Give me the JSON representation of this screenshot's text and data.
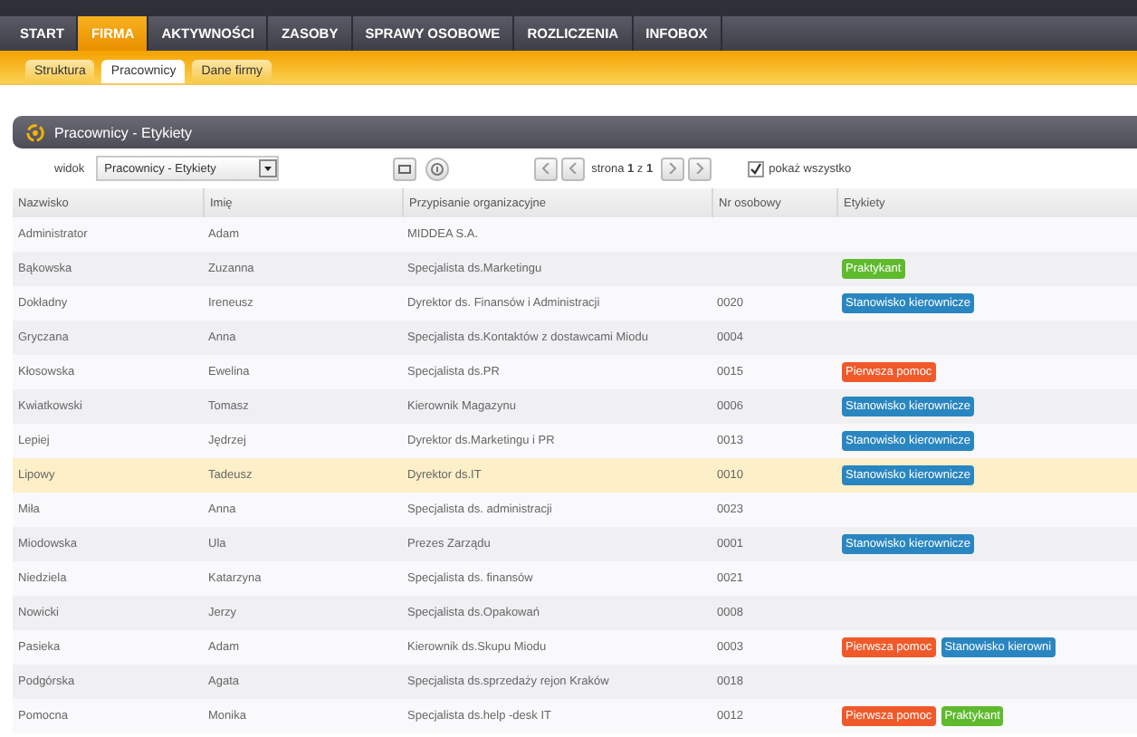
{
  "nav": [
    {
      "label": "START",
      "selected": false
    },
    {
      "label": "FIRMA",
      "selected": true
    },
    {
      "label": "AKTYWNOŚCI",
      "selected": false
    },
    {
      "label": "ZASOBY",
      "selected": false
    },
    {
      "label": "SPRAWY OSOBOWE",
      "selected": false
    },
    {
      "label": "ROZLICZENIA",
      "selected": false
    },
    {
      "label": "INFOBOX",
      "selected": false
    }
  ],
  "subtabs": [
    {
      "label": "Struktura",
      "selected": false
    },
    {
      "label": "Pracownicy",
      "selected": true
    },
    {
      "label": "Dane firmy",
      "selected": false
    }
  ],
  "panel": {
    "title": "Pracownicy - Etykiety"
  },
  "toolbar": {
    "view_label": "widok",
    "view_value": "Pracownicy - Etykiety",
    "pager": "strona **1** z **1**",
    "show_all": {
      "label": "pokaż wszystko",
      "checked": true
    }
  },
  "table": {
    "columns": [
      "Nazwisko",
      "Imię",
      "Przypisanie organizacyjne",
      "Nr osobowy",
      "Etykiety"
    ],
    "rows": [
      {
        "cells": [
          "Administrator",
          "Adam",
          "MIDDEA S.A.",
          ""
        ],
        "selected": false,
        "labels": []
      },
      {
        "cells": [
          "Bąkowska",
          "Zuzanna",
          "Specjalista ds.Marketingu",
          ""
        ],
        "selected": false,
        "labels": [
          {
            "text": "Praktykant",
            "color": "#5fba2e"
          }
        ]
      },
      {
        "cells": [
          "Dokładny",
          "Ireneusz",
          "Dyrektor ds. Finansów i Administracji",
          "0020"
        ],
        "selected": false,
        "labels": [
          {
            "text": "Stanowisko kierownicze",
            "color": "#2a86c0"
          }
        ]
      },
      {
        "cells": [
          "Gryczana",
          "Anna",
          "Specjalista ds.Kontaktów z dostawcami Miodu",
          "0004"
        ],
        "selected": false,
        "labels": []
      },
      {
        "cells": [
          "Kłosowska",
          "Ewelina",
          "Specjalista ds.PR",
          "0015"
        ],
        "selected": false,
        "labels": [
          {
            "text": "Pierwsza pomoc",
            "color": "#f05a2a"
          }
        ]
      },
      {
        "cells": [
          "Kwiatkowski",
          "Tomasz",
          "Kierownik Magazynu",
          "0006"
        ],
        "selected": false,
        "labels": [
          {
            "text": "Stanowisko kierownicze",
            "color": "#2a86c0"
          }
        ]
      },
      {
        "cells": [
          "Lepiej",
          "Jędrzej",
          "Dyrektor ds.Marketingu i PR",
          "0013"
        ],
        "selected": false,
        "labels": [
          {
            "text": "Stanowisko kierownicze",
            "color": "#2a86c0"
          }
        ]
      },
      {
        "cells": [
          "Lipowy",
          "Tadeusz",
          "Dyrektor ds.IT",
          "0010"
        ],
        "selected": true,
        "labels": [
          {
            "text": "Stanowisko kierownicze",
            "color": "#2a86c0"
          }
        ]
      },
      {
        "cells": [
          "Miła",
          "Anna",
          "Specjalista ds. administracji",
          "0023"
        ],
        "selected": false,
        "labels": []
      },
      {
        "cells": [
          "Miodowska",
          "Ula",
          "Prezes Zarządu",
          "0001"
        ],
        "selected": false,
        "labels": [
          {
            "text": "Stanowisko kierownicze",
            "color": "#2a86c0"
          }
        ]
      },
      {
        "cells": [
          "Niedziela",
          "Katarzyna",
          "Specjalista ds. finansów",
          "0021"
        ],
        "selected": false,
        "labels": []
      },
      {
        "cells": [
          "Nowicki",
          "Jerzy",
          "Specjalista ds.Opakowań",
          "0008"
        ],
        "selected": false,
        "labels": []
      },
      {
        "cells": [
          "Pasieka",
          "Adam",
          "Kierownik ds.Skupu Miodu",
          "0003"
        ],
        "selected": false,
        "labels": [
          {
            "text": "Pierwsza pomoc",
            "color": "#f05a2a"
          },
          {
            "text": "Stanowisko kierowni",
            "color": "#2a86c0"
          }
        ]
      },
      {
        "cells": [
          "Podgórska",
          "Agata",
          "Specjalista ds.sprzedaży rejon Kraków",
          "0018"
        ],
        "selected": false,
        "labels": []
      },
      {
        "cells": [
          "Pomocna",
          "Monika",
          "Specjalista ds.help -desk IT",
          "0012"
        ],
        "selected": false,
        "labels": [
          {
            "text": "Pierwsza pomoc",
            "color": "#f05a2a"
          },
          {
            "text": "Praktykant",
            "color": "#5fba2e"
          }
        ]
      }
    ]
  }
}
